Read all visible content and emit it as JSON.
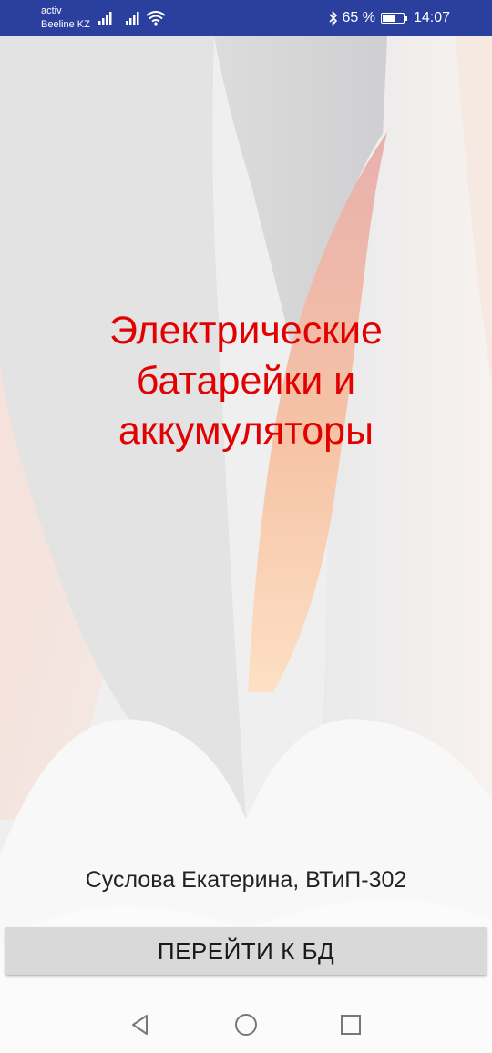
{
  "status_bar": {
    "carrier_1": "activ",
    "carrier_2": "Beeline KZ",
    "battery_percent": "65 %",
    "battery_level": 0.65,
    "time": "14:07",
    "icons": [
      "signal-icon",
      "signal-icon",
      "wifi-icon",
      "bluetooth-icon",
      "battery-icon"
    ]
  },
  "main": {
    "title": "Электрические\nбатарейки и\nаккумуляторы",
    "author": "Суслова Екатерина, ВТиП-302",
    "button_label": "ПЕРЕЙТИ К БД"
  },
  "nav_bar": {
    "icons": [
      "back-icon",
      "home-icon",
      "recents-icon"
    ]
  },
  "colors": {
    "status_bar": "#2b3f9e",
    "title": "#e20000",
    "button": "#d9d9d9"
  }
}
